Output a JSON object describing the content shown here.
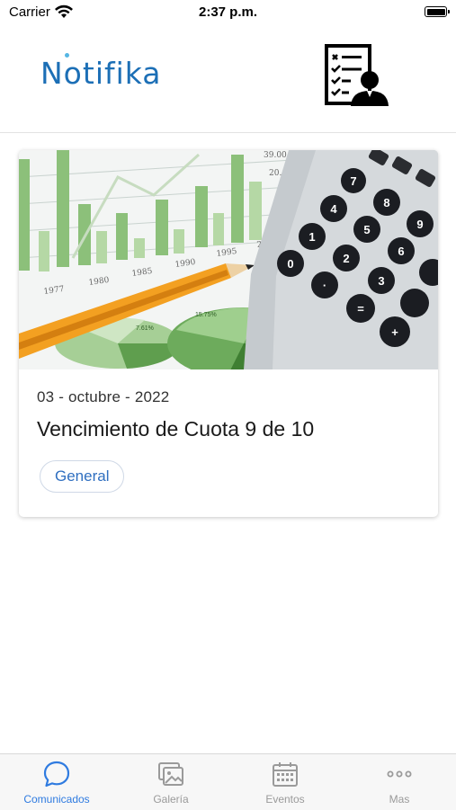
{
  "status_bar": {
    "carrier": "Carrier",
    "time": "2:37 p.m."
  },
  "header": {
    "logo_text": "Notifika",
    "action_icon": "report-checklist-icon"
  },
  "notices": [
    {
      "date": "03 - octubre - 2022",
      "title": "Vencimiento de Cuota 9 de 10",
      "tag": "General",
      "image": "finance-calculator-chart-photo"
    }
  ],
  "tabs": [
    {
      "label": "Comunicados",
      "icon": "chat-bubble-icon",
      "active": true
    },
    {
      "label": "Galería",
      "icon": "gallery-icon",
      "active": false
    },
    {
      "label": "Eventos",
      "icon": "calendar-icon",
      "active": false
    },
    {
      "label": "Mas",
      "icon": "more-icon",
      "active": false
    }
  ],
  "colors": {
    "accent": "#2f7be0",
    "logo": "#1c6fb6",
    "tab_inactive": "#9a9a9a"
  }
}
